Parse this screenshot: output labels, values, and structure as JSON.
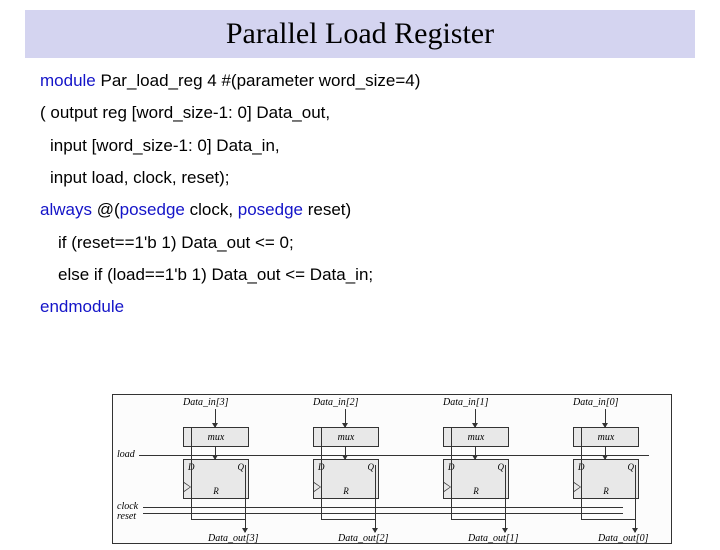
{
  "title": "Parallel Load Register",
  "code": {
    "module_kw": "module",
    "module_decl": " Par_load_reg 4 #(parameter  word_size=4)",
    "port_out": "( output reg [word_size-1: 0] Data_out,",
    "port_in": "input [word_size-1: 0] Data_in,",
    "port_ctrl": "input load, clock, reset);",
    "always_kw": "always",
    "always_at": " @(",
    "posedge1": "posedge",
    "always_mid": " clock, ",
    "posedge2": "posedge",
    "always_end": " reset)",
    "if_line": "if (reset==1'b 1)  Data_out <= 0;",
    "else_line": "else if (load==1'b 1) Data_out <= Data_in;",
    "endmodule": "endmodule"
  },
  "diagram": {
    "inputs": [
      "Data_in[3]",
      "Data_in[2]",
      "Data_in[1]",
      "Data_in[0]"
    ],
    "outputs": [
      "Data_out[3]",
      "Data_out[2]",
      "Data_out[1]",
      "Data_out[0]"
    ],
    "mux_label": "mux",
    "ff": {
      "D": "D",
      "Q": "Q",
      "R": "R"
    },
    "signals": {
      "load": "load",
      "clock": "clock",
      "reset": "reset"
    }
  }
}
